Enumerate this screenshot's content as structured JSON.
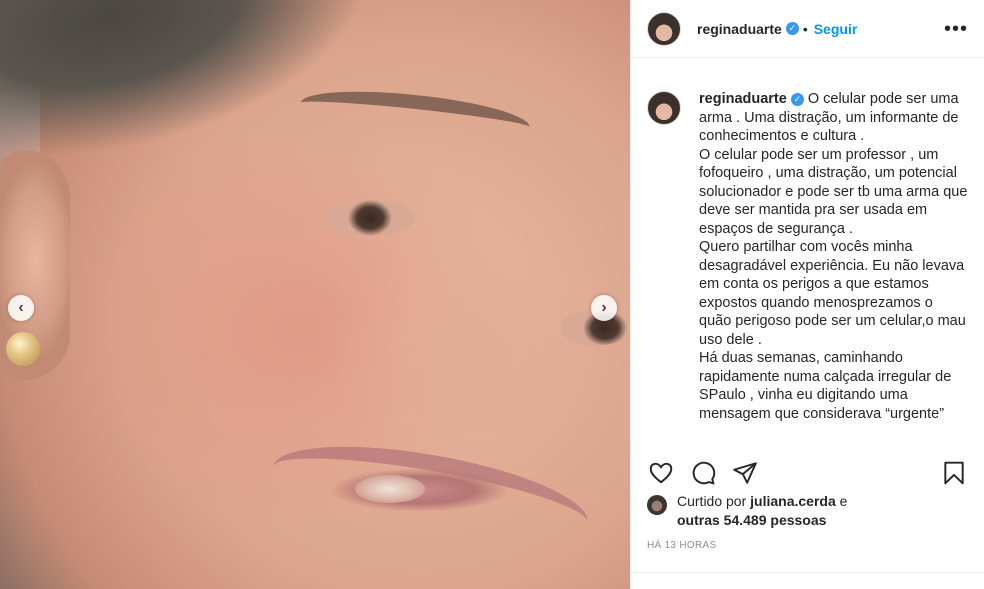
{
  "post": {
    "username": "reginaduarte",
    "follow_label": "Seguir",
    "dot": "•",
    "verified_icon": "✓",
    "more_icon": "•••",
    "photo_nav": {
      "prev": "‹",
      "next": "›"
    },
    "caption": "O celular pode ser uma arma . Uma distração, um informante de conhecimentos e cultura .\nO celular pode ser um professor , um fofoqueiro , uma distração, um potencial solucionador e pode ser tb uma arma que deve ser mantida pra ser usada em espaços de segurança .\nQuero partilhar com vocês minha desagradável experiência. Eu não levava em conta os perigos a que estamos expostos quando menosprezamos o quão perigoso pode ser um celular,o mau uso dele .\nHá duas semanas, caminhando rapidamente numa calçada irregular de SPaulo , vinha eu digitando uma mensagem que considerava “urgente”",
    "likes": {
      "prefix": "Curtido por",
      "liker": "juliana.cerda",
      "conjunction": "e",
      "others": "outras 54.489 pessoas"
    },
    "timestamp": "HÁ 13 HORAS"
  },
  "icons": [
    "heart-icon",
    "comment-icon",
    "share-icon",
    "bookmark-icon"
  ],
  "colors": {
    "accent": "#0095f6",
    "verified": "#3897f0",
    "muted": "#8e8e8e",
    "text": "#262626"
  }
}
